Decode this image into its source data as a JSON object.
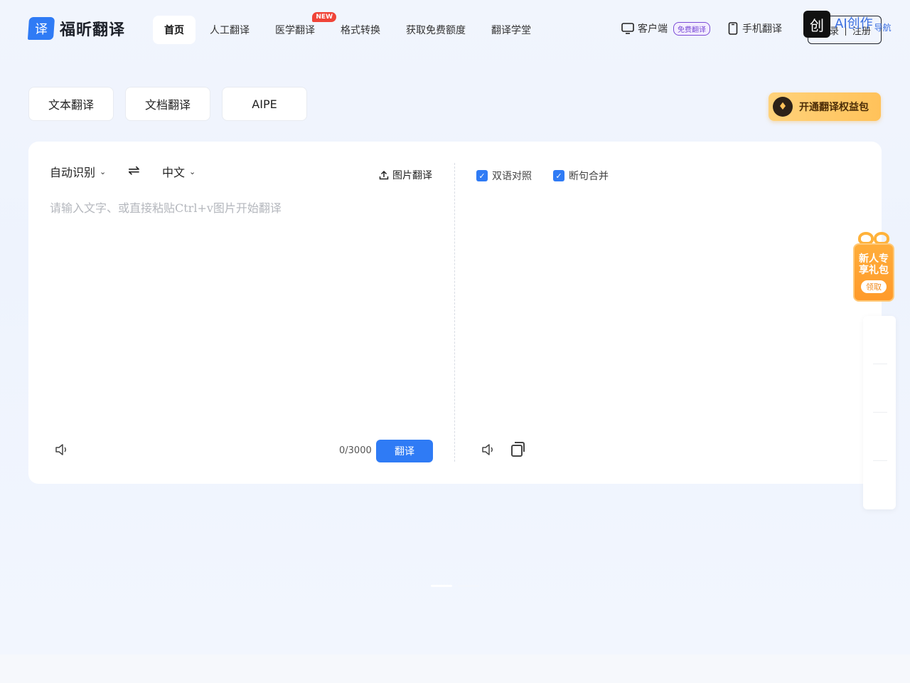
{
  "header": {
    "logo_mark": "译",
    "logo_text": "福昕翻译",
    "nav": [
      {
        "label": "首页",
        "active": true
      },
      {
        "label": "人工翻译"
      },
      {
        "label": "医学翻译",
        "badge": "NEW"
      },
      {
        "label": "格式转换"
      },
      {
        "label": "获取免费额度"
      },
      {
        "label": "翻译学堂"
      }
    ],
    "client_label": "客户端",
    "client_badge": "免费翻译",
    "mobile_label": "手机翻译",
    "login_label": "录",
    "register_label": "注册",
    "watermark_icon": "创",
    "watermark_text": "AI创作",
    "watermark_sub": "导航",
    "icons": {
      "client": "monitor-icon",
      "mobile": "phone-icon"
    }
  },
  "mode_tabs": [
    "文本翻译",
    "文档翻译",
    "AIPE"
  ],
  "vip_button": "开通翻译权益包",
  "source": {
    "language": "自动识别",
    "swap_glyph": "⇌",
    "target_language": "中文",
    "image_translate": "图片翻译",
    "placeholder": "请输入文字、或直接粘贴Ctrl+v图片开始翻译",
    "counter": "0/3000",
    "translate_button": "翻译"
  },
  "target": {
    "bilingual_label": "双语对照",
    "bilingual_checked": true,
    "merge_label": "断句合并",
    "merge_checked": true
  },
  "gift": {
    "title": "新人专享礼包",
    "button": "领取"
  },
  "colors": {
    "accent": "#2f7bf5",
    "badge_new": "#f04438",
    "vip": "#ffc25a",
    "gift": "#ff9a2a"
  }
}
